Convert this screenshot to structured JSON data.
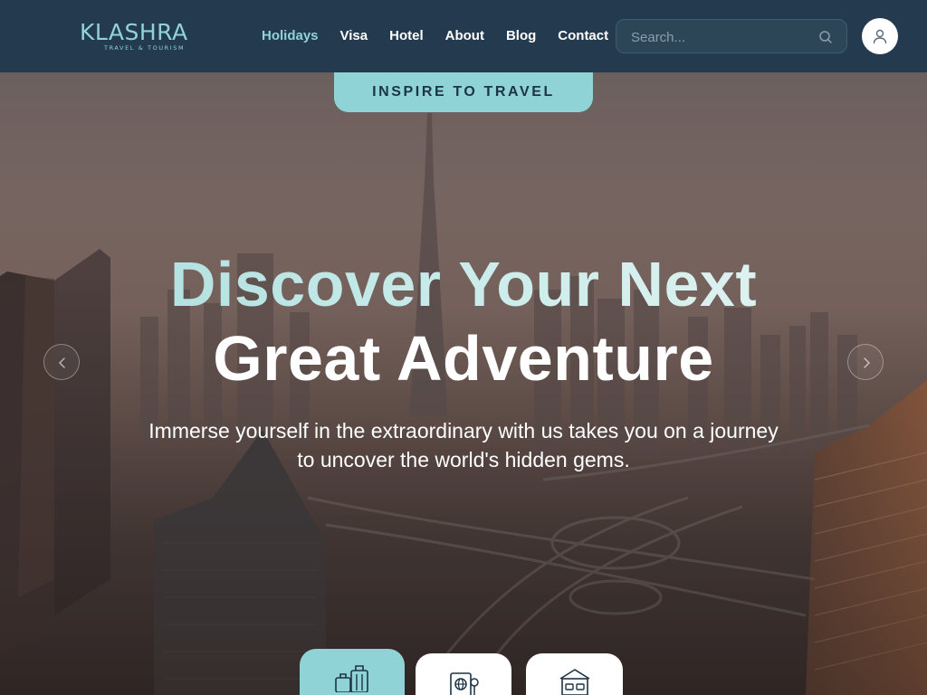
{
  "header": {
    "logo_text": "KLASHRA",
    "logo_tagline": "TRAVEL & TOURISM",
    "nav": [
      {
        "label": "Holidays",
        "active": true
      },
      {
        "label": "Visa",
        "active": false
      },
      {
        "label": "Hotel",
        "active": false
      },
      {
        "label": "About",
        "active": false
      },
      {
        "label": "Blog",
        "active": false
      },
      {
        "label": "Contact",
        "active": false
      }
    ],
    "search_placeholder": "Search...",
    "search_icon": "search-icon",
    "user_icon": "user-icon"
  },
  "hero": {
    "badge": "INSPIRE TO TRAVEL",
    "title_line1": "Discover Your Next",
    "title_line2": "Great Adventure",
    "subtitle": "Immerse yourself in the extraordinary with us takes you on a journey to uncover the world's hidden gems.",
    "prev_icon": "chevron-left-icon",
    "next_icon": "chevron-right-icon"
  },
  "categories": [
    {
      "icon": "luggage-icon",
      "active": true
    },
    {
      "icon": "passport-icon",
      "active": false
    },
    {
      "icon": "hotel-icon",
      "active": false
    }
  ],
  "colors": {
    "header_bg": "#243b4f",
    "accent": "#8fd3d6",
    "text_dark": "#1c3446"
  }
}
